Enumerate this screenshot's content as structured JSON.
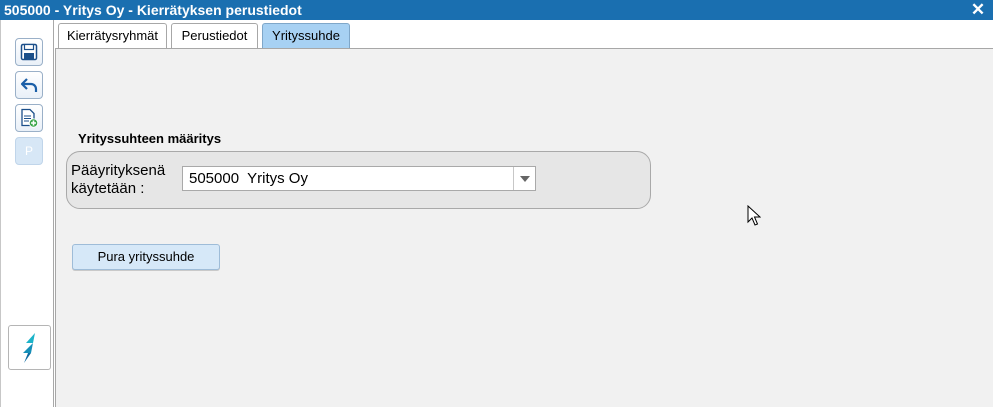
{
  "window": {
    "title": "505000 - Yritys Oy - Kierrätyksen perustiedot",
    "close_symbol": "✕"
  },
  "toolbar": {
    "buttons": [
      {
        "name": "save-icon"
      },
      {
        "name": "undo-icon"
      },
      {
        "name": "new-document-icon"
      },
      {
        "name": "p-button",
        "label": "P"
      }
    ],
    "logo_icon": "app-logo-icon"
  },
  "tabs": [
    {
      "label": "Kierrätysryhmät",
      "active": false
    },
    {
      "label": "Perustiedot",
      "active": false
    },
    {
      "label": "Yrityssuhde",
      "active": true
    }
  ],
  "section": {
    "title": "Yrityssuhteen määritys",
    "field_label": "Pääyrityksenä käytetään :",
    "select_value": "505000  Yritys Oy"
  },
  "actions": {
    "dissolve_label": "Pura yrityssuhde"
  },
  "colors": {
    "titlebar": "#1a6fb0",
    "active_tab": "#a7d1f3",
    "button": "#d6e8f8"
  }
}
